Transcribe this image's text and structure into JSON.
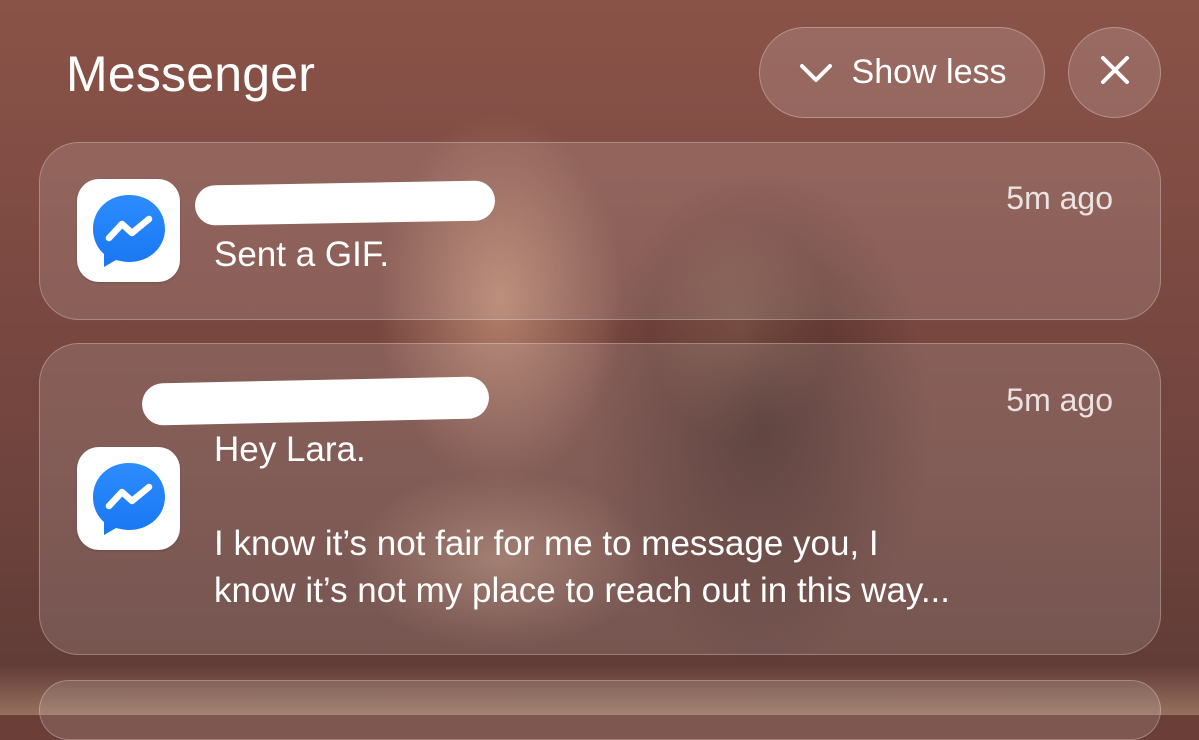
{
  "header": {
    "title": "Messenger",
    "show_less_label": "Show less",
    "show_less_icon": "chevron-down-icon",
    "close_icon": "close-icon"
  },
  "notifications": [
    {
      "app_icon": "messenger-icon",
      "sender_redacted": true,
      "time": "5m ago",
      "message_lines": [
        "Sent a GIF."
      ]
    },
    {
      "app_icon": "messenger-icon",
      "sender_redacted": true,
      "time": "5m ago",
      "message_lines": [
        "Hey Lara.",
        "I know it’s not fair for me to message you, I",
        "know it’s not my place to reach out in this way..."
      ]
    }
  ],
  "colors": {
    "messenger_blue": "#1877F2"
  }
}
